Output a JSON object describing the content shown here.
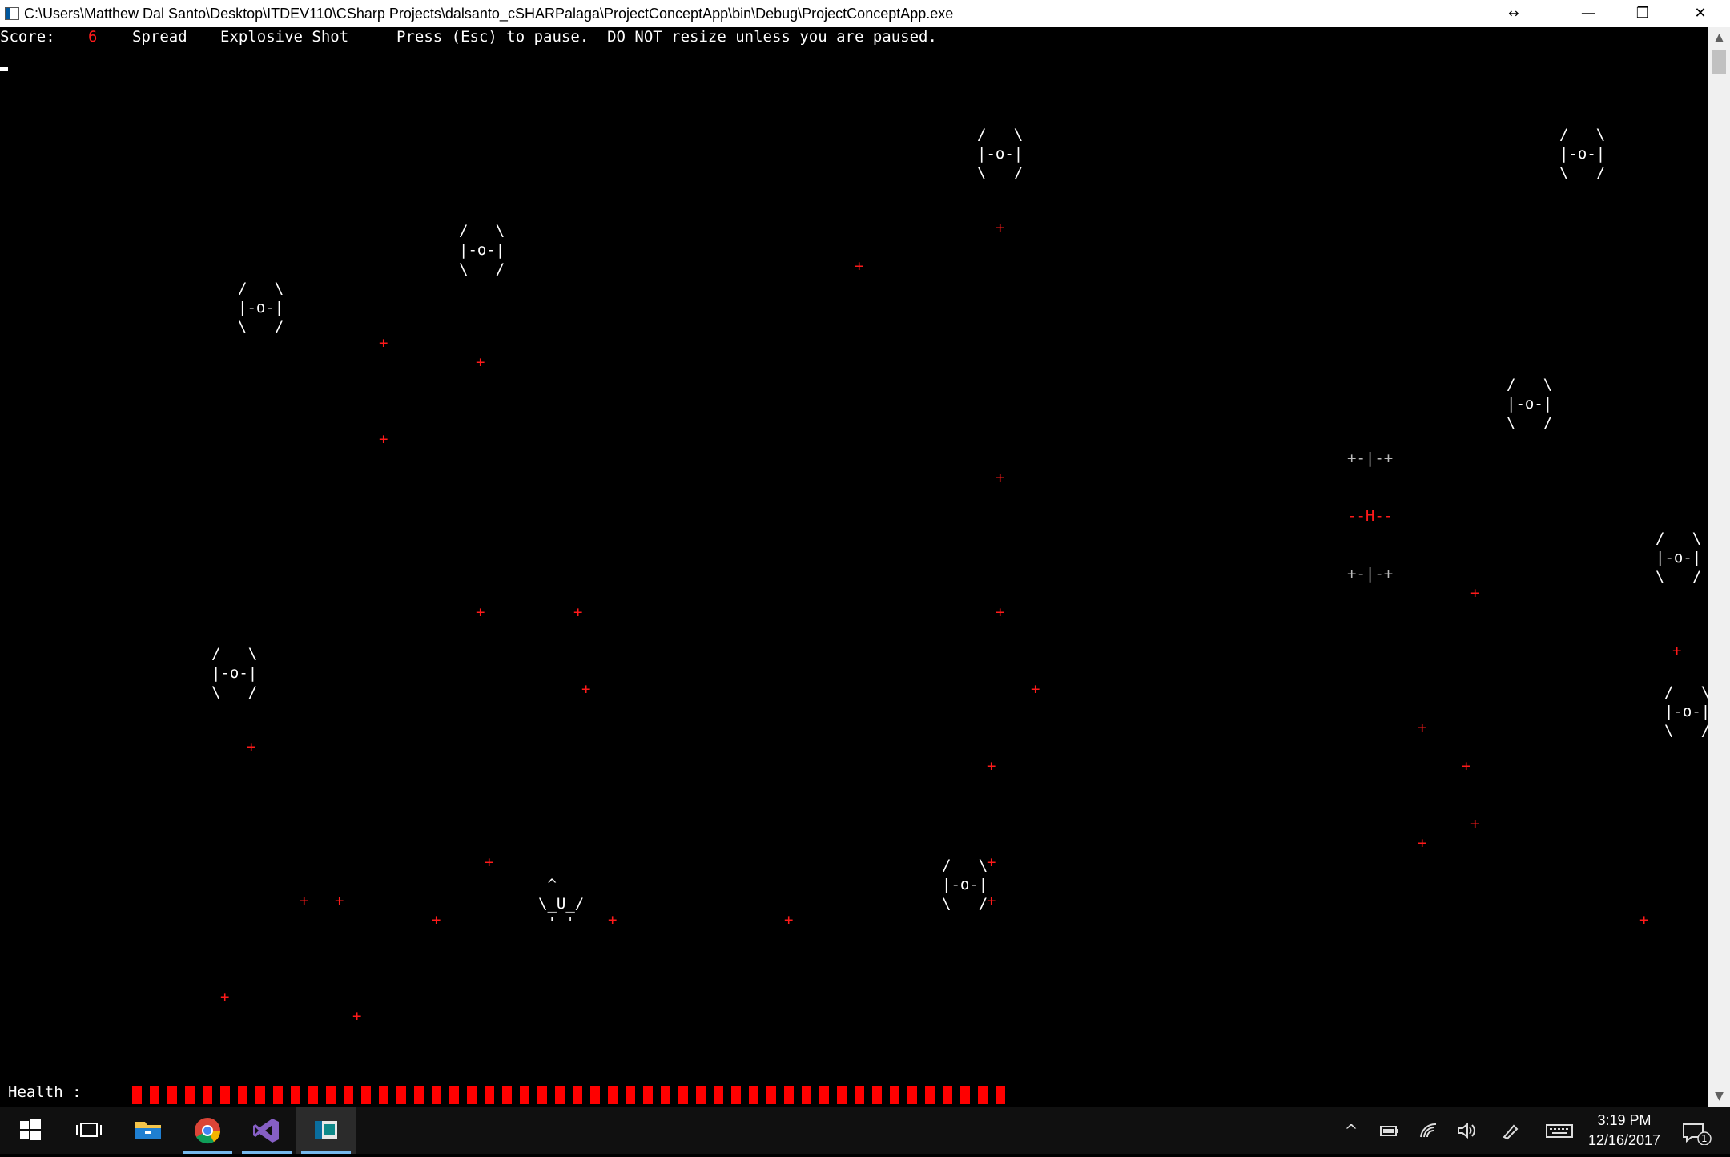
{
  "window": {
    "title": "C:\\Users\\Matthew Dal Santo\\Desktop\\ITDEV110\\CSharp Projects\\dalsanto_cSHARPalaga\\ProjectConceptApp\\bin\\Debug\\ProjectConceptApp.exe",
    "resize_glyph": "↔",
    "min_glyph": "—",
    "max_glyph": "❐",
    "close_glyph": "✕"
  },
  "hud": {
    "score_label": "Score:",
    "score_value": "6",
    "weapon_1": "Spread",
    "weapon_2": "Explosive Shot",
    "pause_hint": "Press (Esc) to pause.  DO NOT resize unless you are paused.",
    "health_label": "Health :",
    "health_segments": 50
  },
  "game": {
    "enemy_sprite": "/   \\\n|-o-|\n\\   /",
    "player_sprite": " ^\n\\_U_/\n ' '",
    "bullet_glyph": "+",
    "powerup": {
      "row1": "+-|-+",
      "row2": "--H--",
      "row3": "+-|-+"
    }
  },
  "scrollbar": {
    "up_glyph": "▲",
    "down_glyph": "▼"
  },
  "taskbar": {
    "apps": [
      {
        "name": "start",
        "icon": "windows-logo-icon"
      },
      {
        "name": "task-view",
        "icon": "task-view-icon"
      },
      {
        "name": "file-explorer",
        "icon": "folder-icon"
      },
      {
        "name": "chrome",
        "icon": "chrome-icon"
      },
      {
        "name": "visual-studio",
        "icon": "visual-studio-icon"
      },
      {
        "name": "console-app",
        "icon": "console-window-icon"
      }
    ],
    "tray": {
      "chevron": "^",
      "clock_time": "3:19 PM",
      "clock_date": "12/16/2017",
      "notification_count": "1"
    },
    "colors": {
      "background": "#101010",
      "accent": "#76b9ed"
    }
  }
}
